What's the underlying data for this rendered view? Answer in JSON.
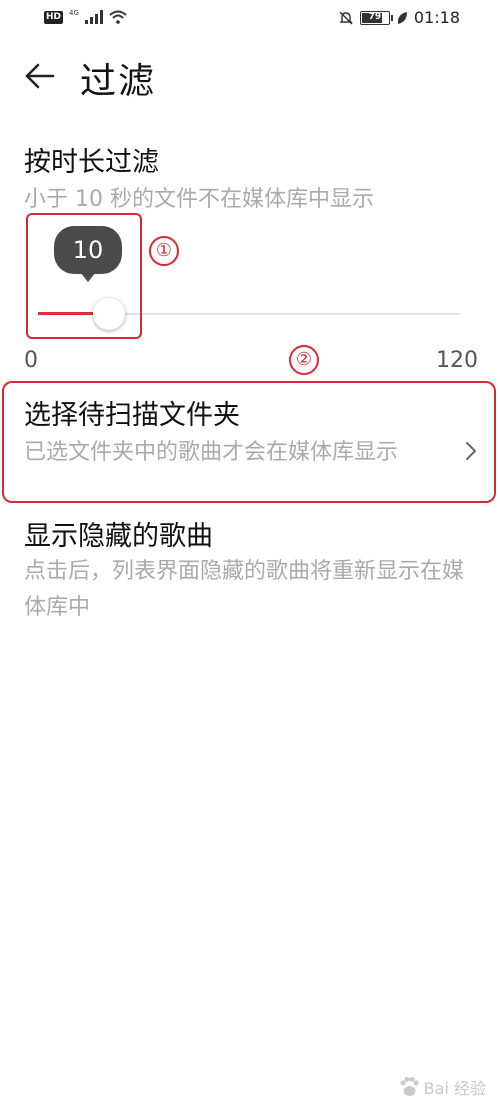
{
  "status_bar": {
    "hd_label": "HD",
    "network_label": "4G",
    "battery_level": 79,
    "battery_text": "79",
    "time": "01:18"
  },
  "header": {
    "title": "过滤"
  },
  "duration_filter": {
    "title": "按时长过滤",
    "subtitle": "小于 10 秒的文件不在媒体库中显示",
    "slider": {
      "value": 10,
      "value_text": "10",
      "min": 0,
      "max": 120,
      "min_label": "0",
      "max_label": "120"
    }
  },
  "folder_select": {
    "title": "选择待扫描文件夹",
    "subtitle": "已选文件夹中的歌曲才会在媒体库显示"
  },
  "hidden_songs": {
    "title": "显示隐藏的歌曲",
    "subtitle": "点击后，列表界面隐藏的歌曲将重新显示在媒体库中"
  },
  "annotations": {
    "marker_1": "①",
    "marker_2": "②"
  },
  "watermark": {
    "text": "Bai 经验"
  },
  "colors": {
    "accent": "#e02b35",
    "annotation": "#d92a34",
    "secondary_text": "#aaaaaa"
  }
}
